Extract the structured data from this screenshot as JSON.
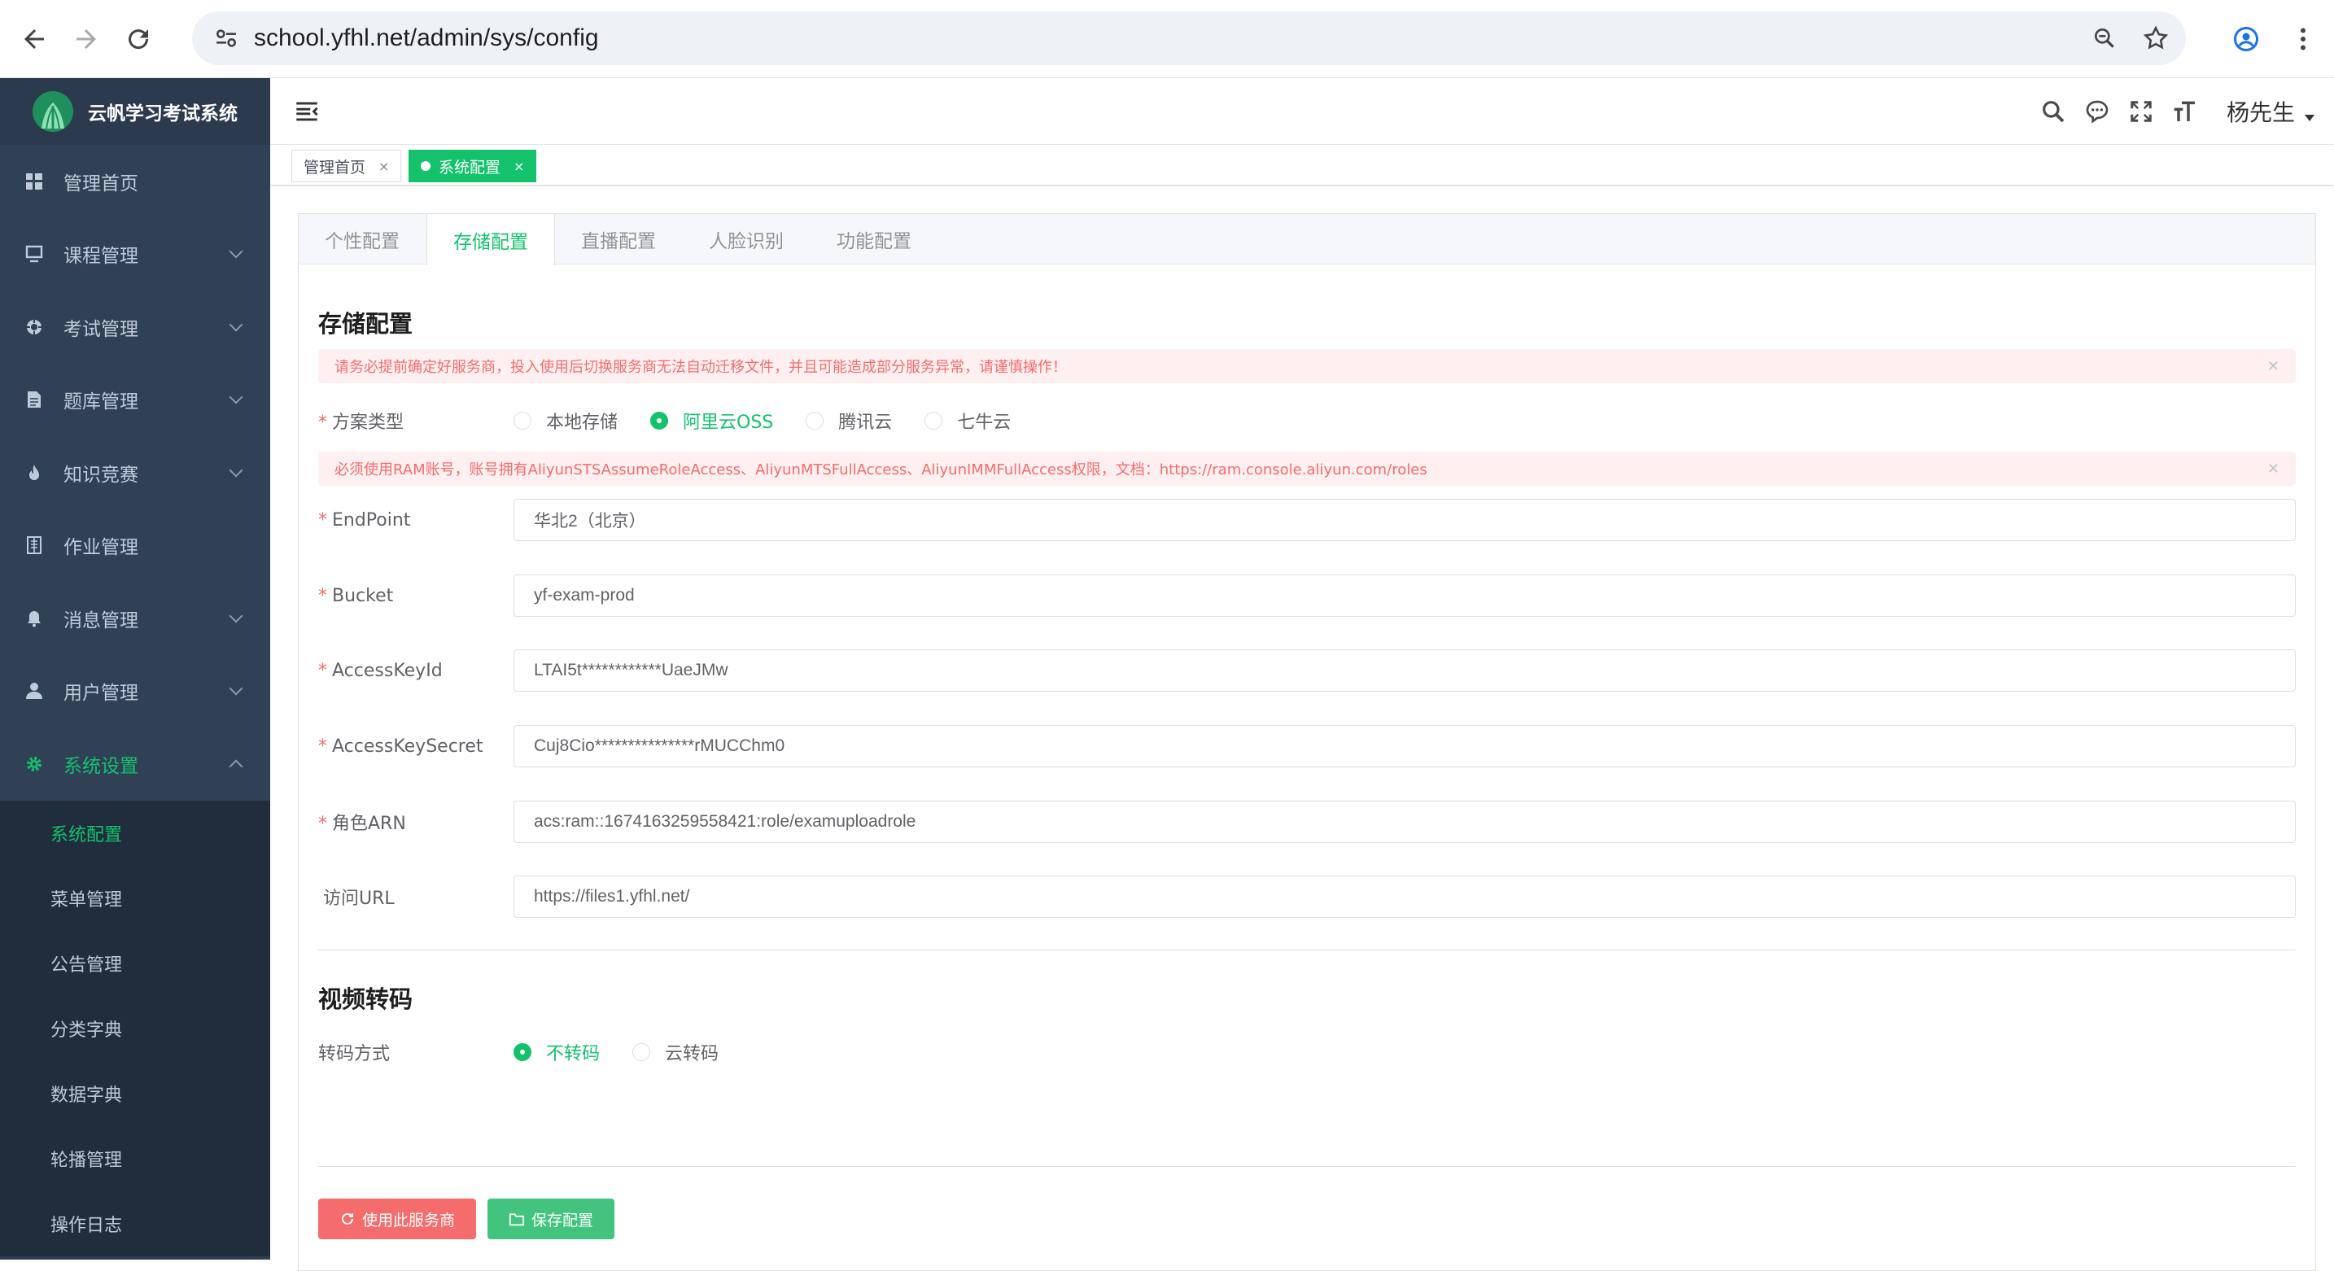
{
  "browser": {
    "url": "school.yfhl.net/admin/sys/config"
  },
  "sidebar": {
    "logo_text": "云帆学习考试系统",
    "items": [
      {
        "label": "管理首页",
        "icon": "dashboard-icon"
      },
      {
        "label": "课程管理",
        "icon": "monitor-icon"
      },
      {
        "label": "考试管理",
        "icon": "target-icon"
      },
      {
        "label": "题库管理",
        "icon": "document-icon"
      },
      {
        "label": "知识竞赛",
        "icon": "fire-icon"
      },
      {
        "label": "作业管理",
        "icon": "notebook-icon"
      },
      {
        "label": "消息管理",
        "icon": "bell-icon"
      },
      {
        "label": "用户管理",
        "icon": "user-icon"
      },
      {
        "label": "系统设置",
        "icon": "gear-icon"
      }
    ],
    "submenu": [
      "系统配置",
      "菜单管理",
      "公告管理",
      "分类字典",
      "数据字典",
      "轮播管理",
      "操作日志"
    ]
  },
  "header": {
    "user_name": "杨先生"
  },
  "tags": [
    {
      "label": "管理首页"
    },
    {
      "label": "系统配置"
    }
  ],
  "tabs": [
    "个性配置",
    "存储配置",
    "直播配置",
    "人脸识别",
    "功能配置"
  ],
  "storage": {
    "title": "存储配置",
    "warning": "请务必提前确定好服务商，投入使用后切换服务商无法自动迁移文件，并且可能造成部分服务异常，请谨慎操作！",
    "scheme_label": "方案类型",
    "scheme_options": [
      "本地存储",
      "阿里云OSS",
      "腾讯云",
      "七牛云"
    ],
    "ram_notice": "必须使用RAM账号，账号拥有AliyunSTSAssumeRoleAccess、AliyunMTSFullAccess、AliyunIMMFullAccess权限，文档：https://ram.console.aliyun.com/roles",
    "fields": [
      {
        "label": "EndPoint",
        "value": "华北2（北京）",
        "required": "*"
      },
      {
        "label": "Bucket",
        "value": "yf-exam-prod",
        "required": "*"
      },
      {
        "label": "AccessKeyId",
        "value": "LTAI5t************UaeJMw",
        "required": "*"
      },
      {
        "label": "AccessKeySecret",
        "value": "Cuj8Cio***************rMUCChm0",
        "required": "*"
      },
      {
        "label": "角色ARN",
        "value": "acs:ram::1674163259558421:role/examuploadrole",
        "required": "*"
      },
      {
        "label": "访问URL",
        "value": "https://files1.yfhl.net/",
        "required": ""
      }
    ]
  },
  "video": {
    "title": "视频转码",
    "mode_label": "转码方式",
    "options": [
      "不转码",
      "云转码"
    ]
  },
  "buttons": {
    "use_provider": "使用此服务商",
    "save": "保存配置"
  },
  "colors": {
    "accent": "#13c26b",
    "sidebar_bg": "#304156",
    "danger": "#f56c6c"
  }
}
